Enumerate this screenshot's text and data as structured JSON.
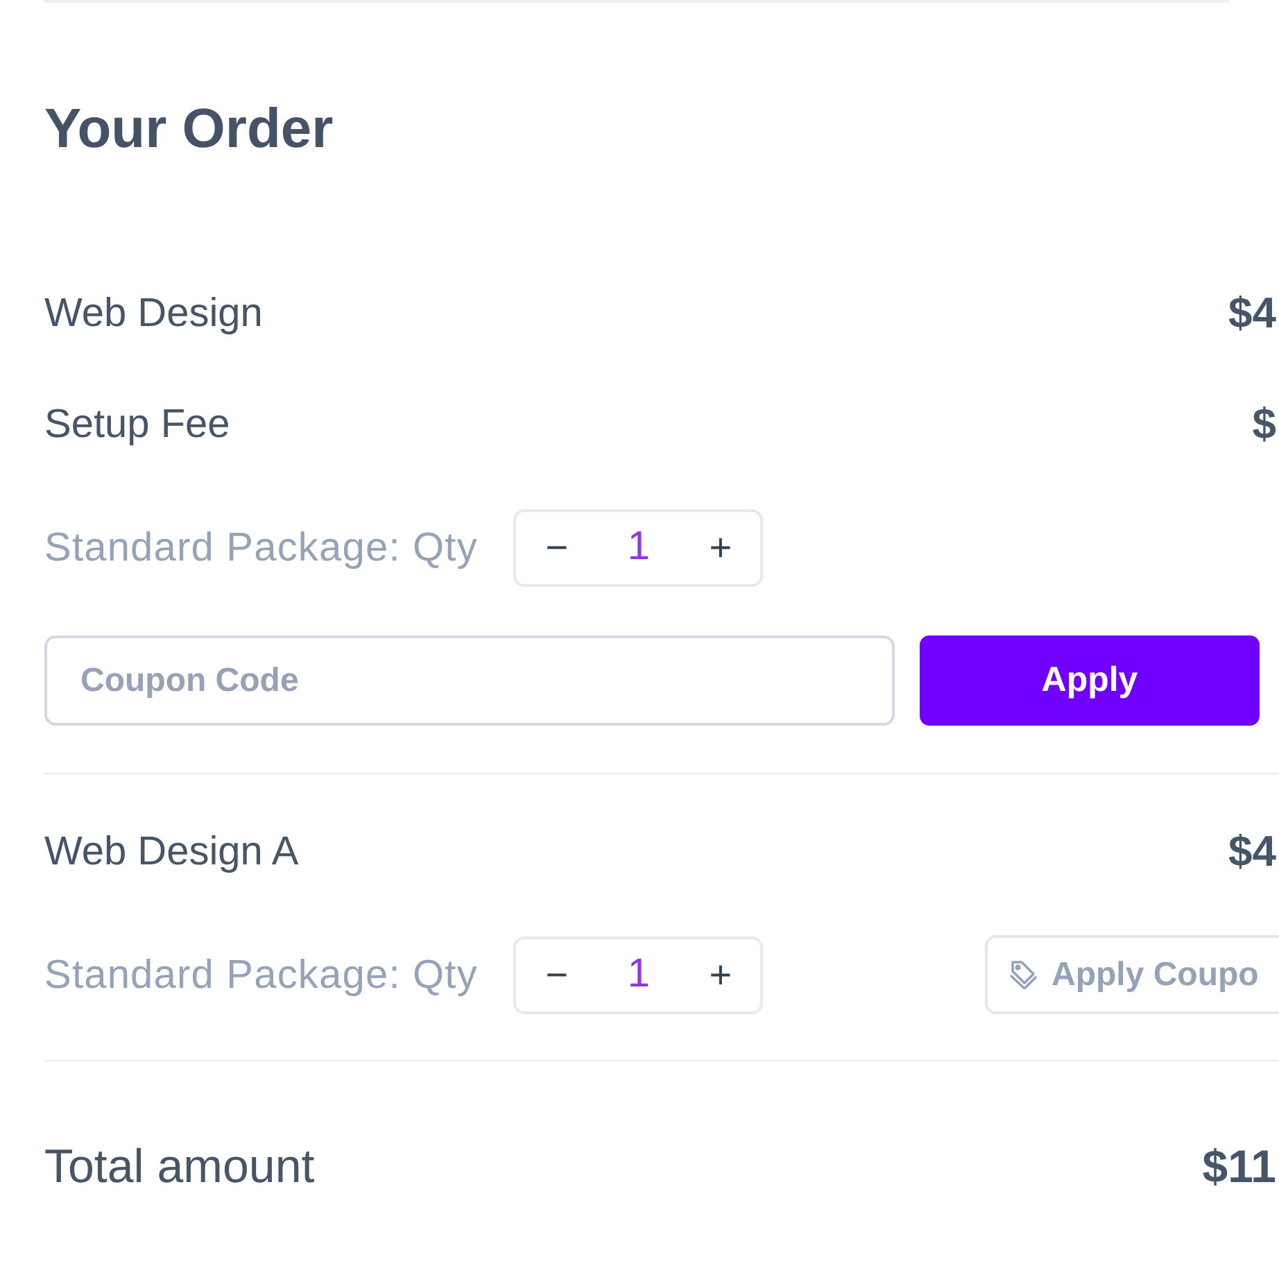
{
  "title": "Your Order",
  "sections": [
    {
      "lines": [
        {
          "kind": "line",
          "label": "Web Design",
          "price": "$4"
        },
        {
          "kind": "line",
          "label": "Setup Fee",
          "price": "$"
        },
        {
          "kind": "qty",
          "label": "Standard Package: Qty",
          "decrement": "−",
          "quantity": "1",
          "increment": "+"
        },
        {
          "kind": "coupon_form",
          "placeholder": "Coupon Code",
          "button": "Apply"
        }
      ]
    },
    {
      "lines": [
        {
          "kind": "line",
          "label": "Web Design A",
          "price": "$4"
        },
        {
          "kind": "qty",
          "label": "Standard Package: Qty",
          "decrement": "−",
          "quantity": "1",
          "increment": "+",
          "coupon_button": "Apply Coupo"
        }
      ]
    }
  ],
  "total": {
    "label": "Total amount",
    "amount": "$11"
  }
}
